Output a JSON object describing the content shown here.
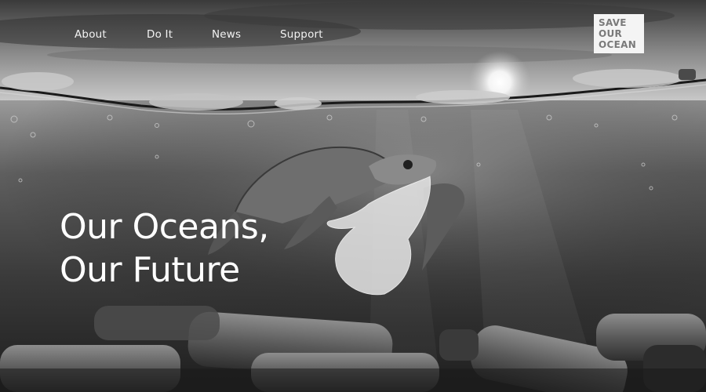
{
  "nav": {
    "items": [
      {
        "label": "About"
      },
      {
        "label": "Do It"
      },
      {
        "label": "News"
      },
      {
        "label": "Support"
      }
    ]
  },
  "logo": {
    "lines": [
      "SAVE",
      "OUR",
      "OCEAN"
    ]
  },
  "hero": {
    "headline_line1": "Our Oceans,",
    "headline_line2": "Our Future"
  },
  "colors": {
    "text": "#ffffff",
    "logo_bg": "#f4f4f4",
    "logo_text": "#7a7a7a"
  },
  "icons": [
    "sea-turtle-illustration",
    "plastic-bag-illustration",
    "plastic-bottle-illustration",
    "sun-illustration"
  ]
}
